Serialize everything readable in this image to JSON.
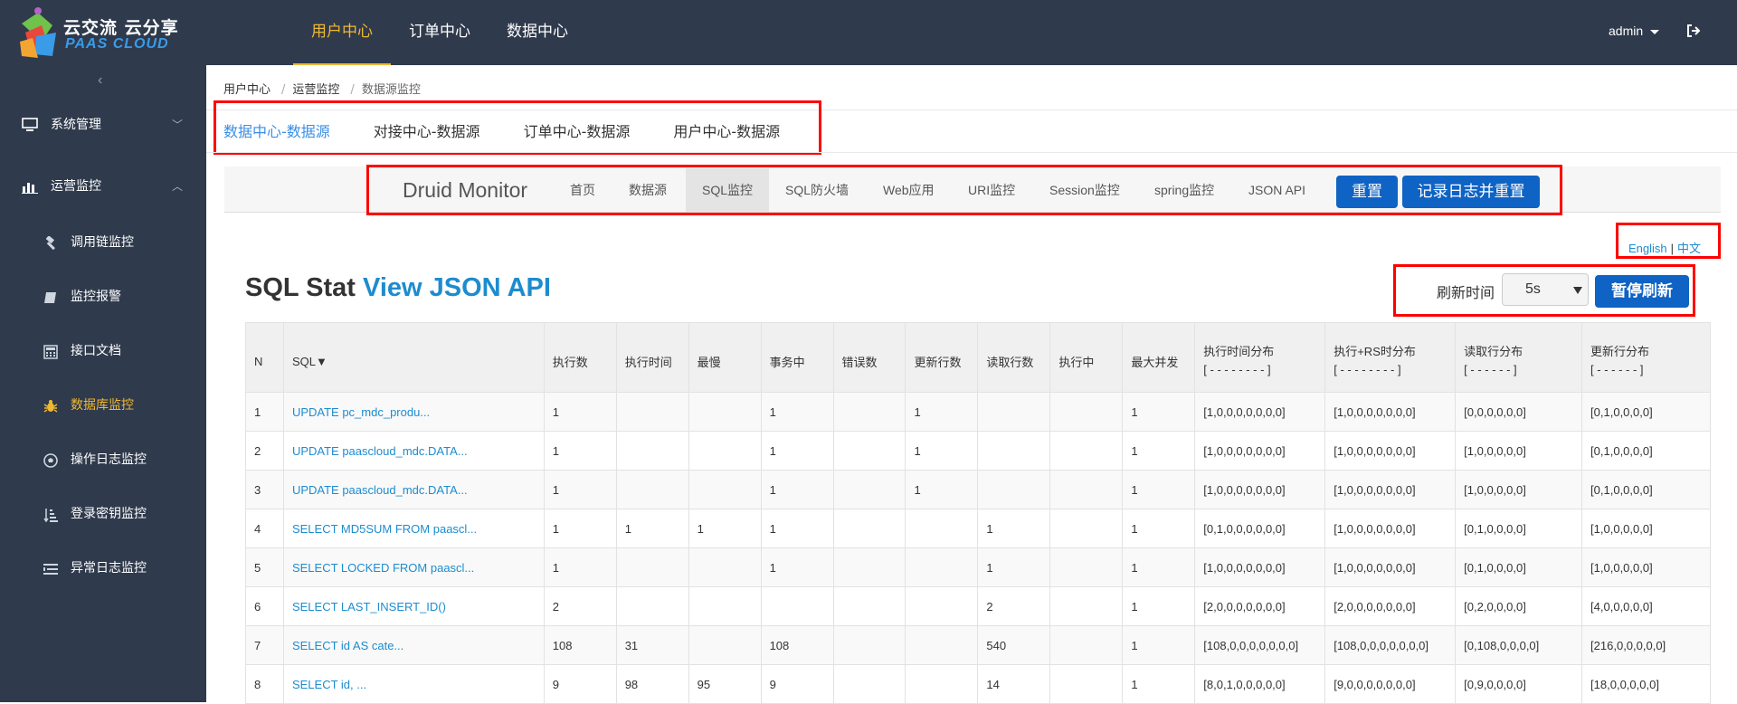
{
  "logo": {
    "line1": "云交流 云分享",
    "line2": "PAAS CLOUD"
  },
  "topnav": [
    "用户中心",
    "订单中心",
    "数据中心"
  ],
  "user": {
    "name": "admin"
  },
  "sidebar": {
    "collapse_icon": "chevron-left-icon",
    "menus": [
      {
        "label": "系统管理",
        "icon": "monitor-icon"
      },
      {
        "label": "运营监控",
        "icon": "bar-chart-icon"
      }
    ],
    "subitems": [
      {
        "label": "调用链监控",
        "icon": "gavel-icon"
      },
      {
        "label": "监控报警",
        "icon": "book-icon"
      },
      {
        "label": "接口文档",
        "icon": "calculator-icon"
      },
      {
        "label": "数据库监控",
        "icon": "bug-icon"
      },
      {
        "label": "操作日志监控",
        "icon": "soccer-icon"
      },
      {
        "label": "登录密钥监控",
        "icon": "sort-icon"
      },
      {
        "label": "异常日志监控",
        "icon": "list-icon"
      }
    ]
  },
  "breadcrumb": [
    "用户中心",
    "运营监控",
    "数据源监控"
  ],
  "ds_tabs": [
    "数据中心-数据源",
    "对接中心-数据源",
    "订单中心-数据源",
    "用户中心-数据源"
  ],
  "druid": {
    "brand": "Druid Monitor",
    "nav": [
      "首页",
      "数据源",
      "SQL监控",
      "SQL防火墙",
      "Web应用",
      "URI监控",
      "Session监控",
      "spring监控",
      "JSON API"
    ],
    "reset": "重置",
    "log_reset": "记录日志并重置"
  },
  "lang": {
    "en": "English",
    "zh": "中文"
  },
  "title": {
    "prefix": "SQL Stat",
    "link": "View JSON API"
  },
  "refresh": {
    "label": "刷新时间",
    "value": "5s",
    "pause": "暂停刷新"
  },
  "table": {
    "headers": [
      "N",
      "SQL▼",
      "执行数",
      "执行时间",
      "最慢",
      "事务中",
      "错误数",
      "更新行数",
      "读取行数",
      "执行中",
      "最大并发"
    ],
    "dist_headers": [
      {
        "label": "执行时间分布",
        "sub": "[ - - - - - - - - ]"
      },
      {
        "label": "执行+RS时分布",
        "sub": "[ - - - - - - - - ]"
      },
      {
        "label": "读取行分布",
        "sub": "[ - - - - - - ]"
      },
      {
        "label": "更新行分布",
        "sub": "[ - - - - - - ]"
      }
    ],
    "rows": [
      [
        "1",
        "UPDATE pc_mdc_produ...",
        "1",
        "",
        "",
        "1",
        "",
        "1",
        "",
        "",
        "1",
        "[1,0,0,0,0,0,0,0]",
        "[1,0,0,0,0,0,0,0]",
        "[0,0,0,0,0,0]",
        "[0,1,0,0,0,0]"
      ],
      [
        "2",
        "UPDATE paascloud_mdc.DATA...",
        "1",
        "",
        "",
        "1",
        "",
        "1",
        "",
        "",
        "1",
        "[1,0,0,0,0,0,0,0]",
        "[1,0,0,0,0,0,0,0]",
        "[1,0,0,0,0,0]",
        "[0,1,0,0,0,0]"
      ],
      [
        "3",
        "UPDATE paascloud_mdc.DATA...",
        "1",
        "",
        "",
        "1",
        "",
        "1",
        "",
        "",
        "1",
        "[1,0,0,0,0,0,0,0]",
        "[1,0,0,0,0,0,0,0]",
        "[1,0,0,0,0,0]",
        "[0,1,0,0,0,0]"
      ],
      [
        "4",
        "SELECT MD5SUM FROM paascl...",
        "1",
        "1",
        "1",
        "1",
        "",
        "",
        "1",
        "",
        "1",
        "[0,1,0,0,0,0,0,0]",
        "[1,0,0,0,0,0,0,0]",
        "[0,1,0,0,0,0]",
        "[1,0,0,0,0,0]"
      ],
      [
        "5",
        "SELECT LOCKED FROM paascl...",
        "1",
        "",
        "",
        "1",
        "",
        "",
        "1",
        "",
        "1",
        "[1,0,0,0,0,0,0,0]",
        "[1,0,0,0,0,0,0,0]",
        "[0,1,0,0,0,0]",
        "[1,0,0,0,0,0]"
      ],
      [
        "6",
        "SELECT LAST_INSERT_ID()",
        "2",
        "",
        "",
        "",
        "",
        "",
        "2",
        "",
        "1",
        "[2,0,0,0,0,0,0,0]",
        "[2,0,0,0,0,0,0,0]",
        "[0,2,0,0,0,0]",
        "[4,0,0,0,0,0]"
      ],
      [
        "7",
        "SELECT id AS cate...",
        "108",
        "31",
        "",
        "108",
        "",
        "",
        "540",
        "",
        "1",
        "[108,0,0,0,0,0,0,0]",
        "[108,0,0,0,0,0,0,0]",
        "[0,108,0,0,0,0]",
        "[216,0,0,0,0,0]"
      ],
      [
        "8",
        "SELECT id, ...",
        "9",
        "98",
        "95",
        "9",
        "",
        "",
        "14",
        "",
        "1",
        "[8,0,1,0,0,0,0,0]",
        "[9,0,0,0,0,0,0,0]",
        "[0,9,0,0,0,0]",
        "[18,0,0,0,0,0]"
      ]
    ]
  },
  "colors": {
    "topbar": "#2f3a4c",
    "accent": "#f0b830",
    "link": "#1d8ccf",
    "button": "#0e63c4",
    "highlight": "#ff0000"
  }
}
